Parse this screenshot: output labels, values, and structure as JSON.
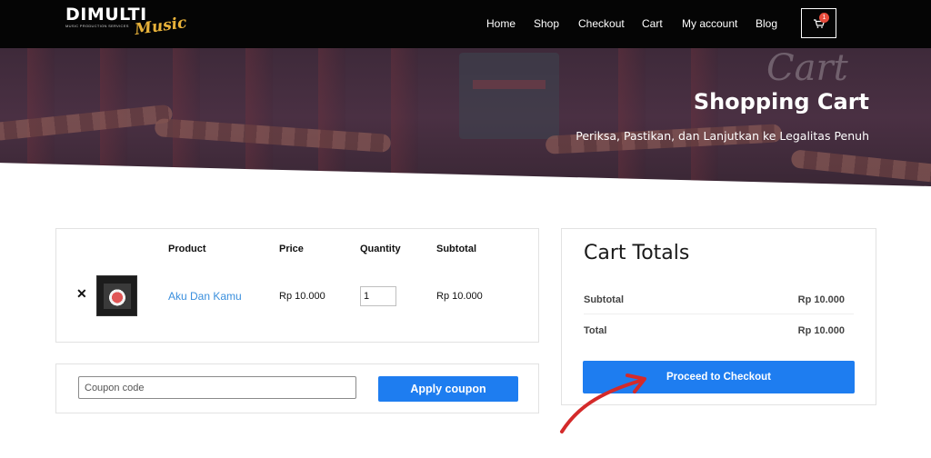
{
  "header": {
    "logo": {
      "main": "DIMULTI",
      "tagline": "MUSIC PRODUCTION SERVICES",
      "script": "Music"
    },
    "nav": [
      {
        "label": "Home"
      },
      {
        "label": "Shop"
      },
      {
        "label": "Checkout"
      },
      {
        "label": "Cart"
      },
      {
        "label": "My account"
      },
      {
        "label": "Blog"
      }
    ],
    "cart": {
      "icon": "cart-icon",
      "count": "1"
    }
  },
  "hero": {
    "script_text": "Cart",
    "title": "Shopping Cart",
    "subtitle": "Periksa, Pastikan, dan Lanjutkan ke Legalitas Penuh"
  },
  "cart_table": {
    "headers": {
      "product": "Product",
      "price": "Price",
      "quantity": "Quantity",
      "subtotal": "Subtotal"
    },
    "rows": [
      {
        "remove_icon": "close-icon",
        "product": "Aku Dan Kamu",
        "price": "Rp 10.000",
        "quantity": "1",
        "subtotal": "Rp 10.000"
      }
    ]
  },
  "coupon": {
    "placeholder": "Coupon code",
    "button_label": "Apply coupon"
  },
  "totals": {
    "title": "Cart Totals",
    "subtotal_label": "Subtotal",
    "subtotal_value": "Rp 10.000",
    "total_label": "Total",
    "total_value": "Rp 10.000",
    "checkout_label": "Proceed to Checkout"
  },
  "colors": {
    "accent": "#1e7df0",
    "link": "#3a8fdd",
    "header_bg": "#050505",
    "annotation_arrow": "#d42a2a",
    "badge": "#e74c3c"
  }
}
